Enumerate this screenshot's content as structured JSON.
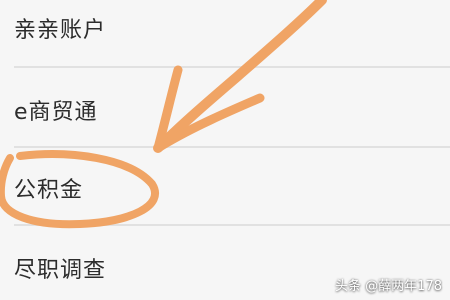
{
  "menu": {
    "items": [
      {
        "label": "亲亲账户"
      },
      {
        "label": "e商贸通"
      },
      {
        "label": "公积金"
      },
      {
        "label": "尽职调查"
      }
    ]
  },
  "annotation": {
    "color": "#f0a465",
    "arrow_icon": "hand-drawn-arrow-icon",
    "circle_icon": "hand-drawn-circle-icon"
  },
  "watermark": {
    "text": "头条 @薛两年178"
  }
}
